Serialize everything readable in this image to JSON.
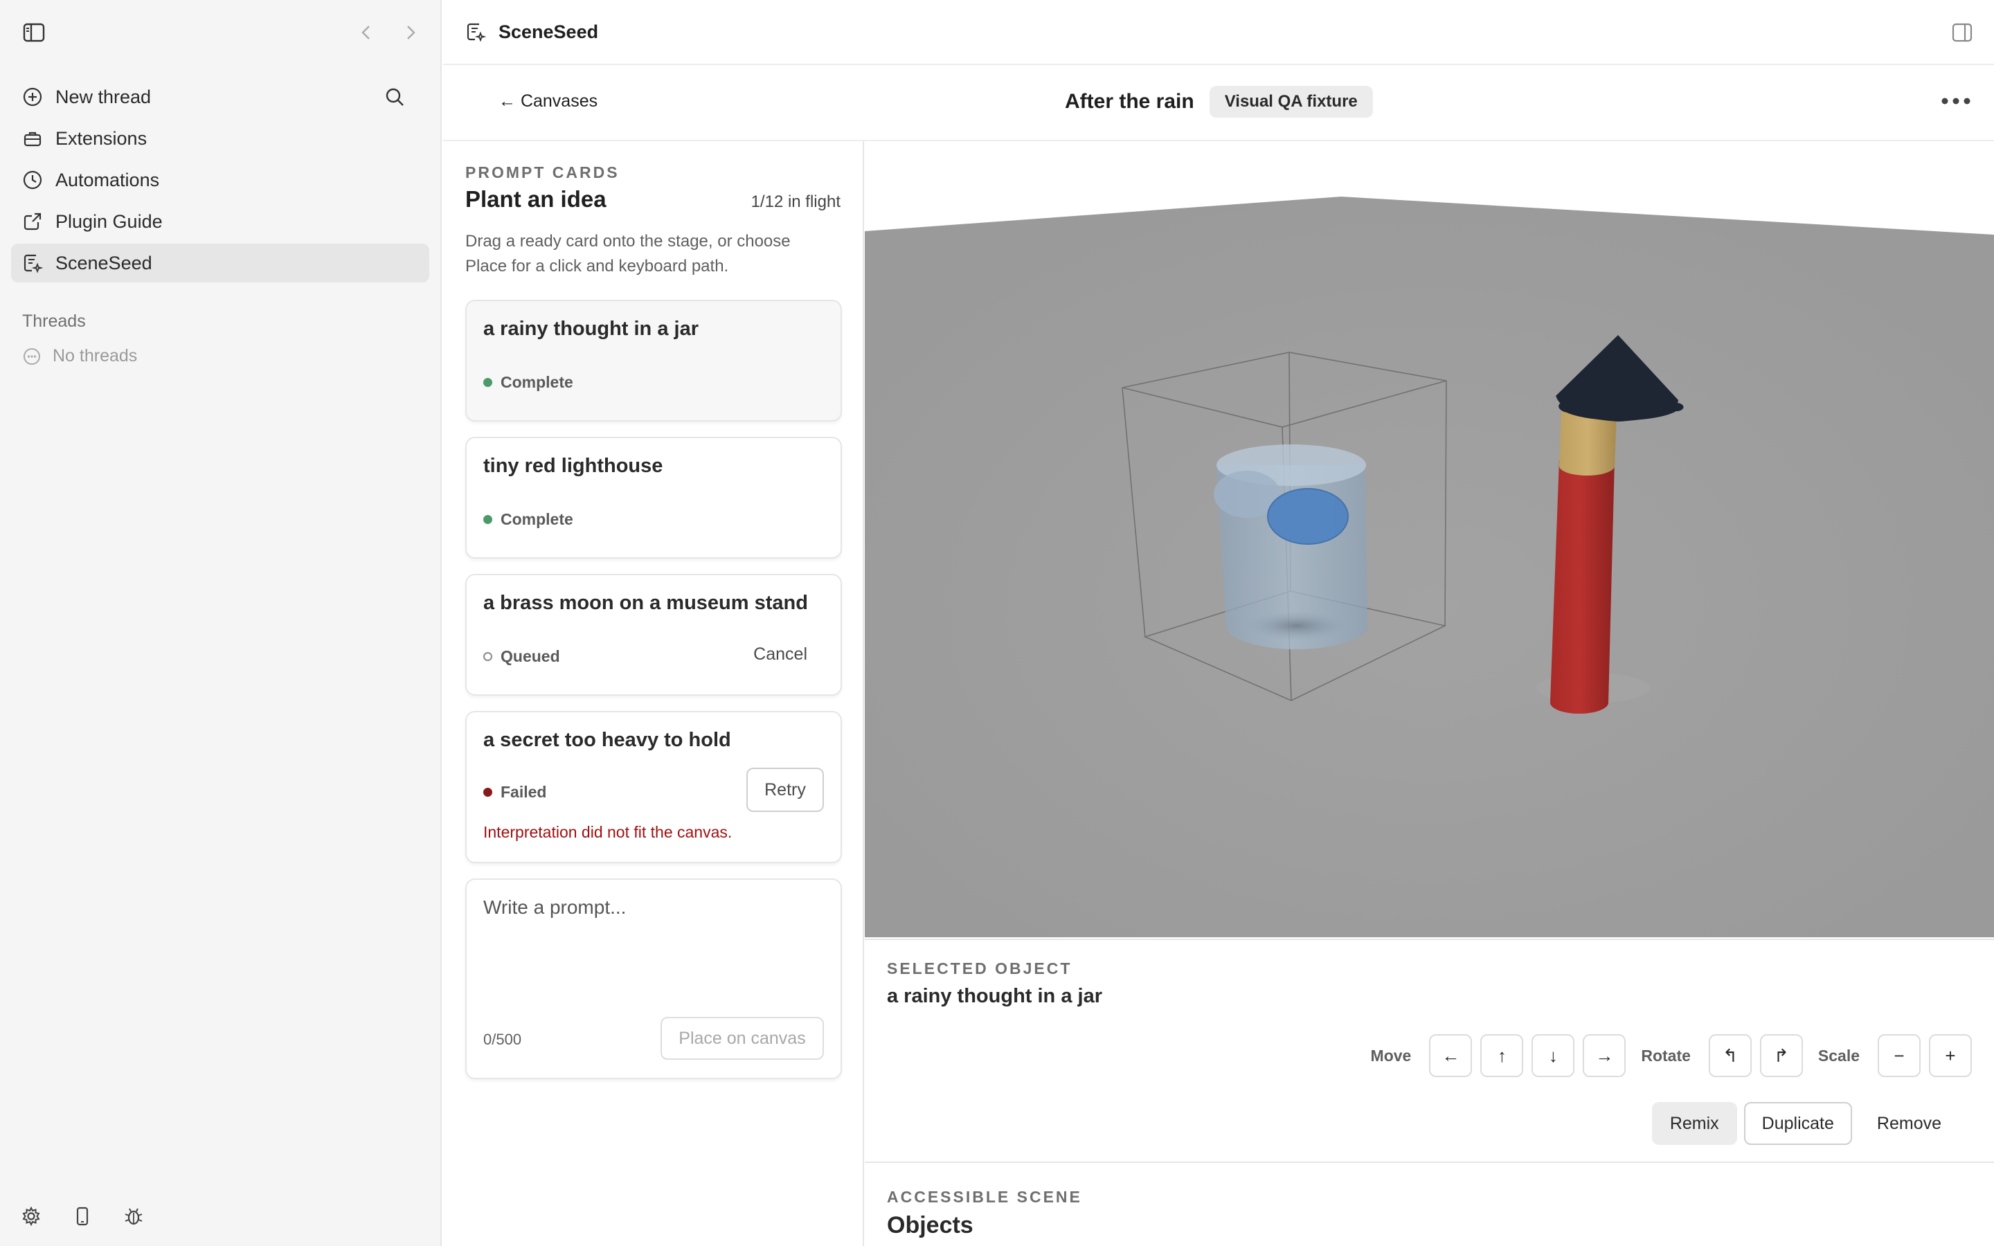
{
  "sidebar": {
    "items": [
      {
        "label": "New thread",
        "icon": "plus-circle-icon"
      },
      {
        "label": "Extensions",
        "icon": "toolbox-icon"
      },
      {
        "label": "Automations",
        "icon": "clock-icon"
      },
      {
        "label": "Plugin Guide",
        "icon": "external-link-icon"
      },
      {
        "label": "SceneSeed",
        "icon": "document-sparkle-icon"
      }
    ],
    "section_label": "Threads",
    "empty_label": "No threads"
  },
  "topbar": {
    "app_title": "SceneSeed"
  },
  "canvas_header": {
    "back_label": "← Canvases",
    "title": "After the rain",
    "badge": "Visual QA fixture"
  },
  "prompt_panel": {
    "eyebrow": "PROMPT CARDS",
    "title": "Plant an idea",
    "in_flight": "1/12 in flight",
    "help": "Drag a ready card onto the stage, or choose Place for a click and keyboard path.",
    "cards": [
      {
        "title": "a rainy thought in a jar",
        "status": "Complete"
      },
      {
        "title": "tiny red lighthouse",
        "status": "Complete"
      },
      {
        "title": "a brass moon on a museum stand",
        "status": "Queued",
        "action": "Cancel"
      },
      {
        "title": "a secret too heavy to hold",
        "status": "Failed",
        "action": "Retry",
        "error": "Interpretation did not fit the canvas."
      }
    ],
    "composer": {
      "placeholder": "Write a prompt...",
      "value": "",
      "count": "0/500",
      "submit": "Place on canvas"
    }
  },
  "inspector": {
    "eyebrow": "SELECTED OBJECT",
    "name": "a rainy thought in a jar",
    "move_label": "Move",
    "move": [
      "←",
      "↑",
      "↓",
      "→"
    ],
    "rotate_label": "Rotate",
    "rotate": [
      "↰",
      "↱"
    ],
    "scale_label": "Scale",
    "scale": [
      "−",
      "+"
    ],
    "actions": [
      "Remix",
      "Duplicate",
      "Remove"
    ]
  },
  "accessible_scene": {
    "eyebrow": "ACCESSIBLE SCENE",
    "title": "Objects"
  },
  "colors": {
    "stage_bg": "#9d9d9d",
    "status_complete": "#4a9a6a",
    "status_failed": "#8a1a1a",
    "error_text": "#a01010",
    "lighthouse_body": "#b3302d",
    "lighthouse_band": "#c8a868",
    "lighthouse_roof": "#1e2533"
  }
}
